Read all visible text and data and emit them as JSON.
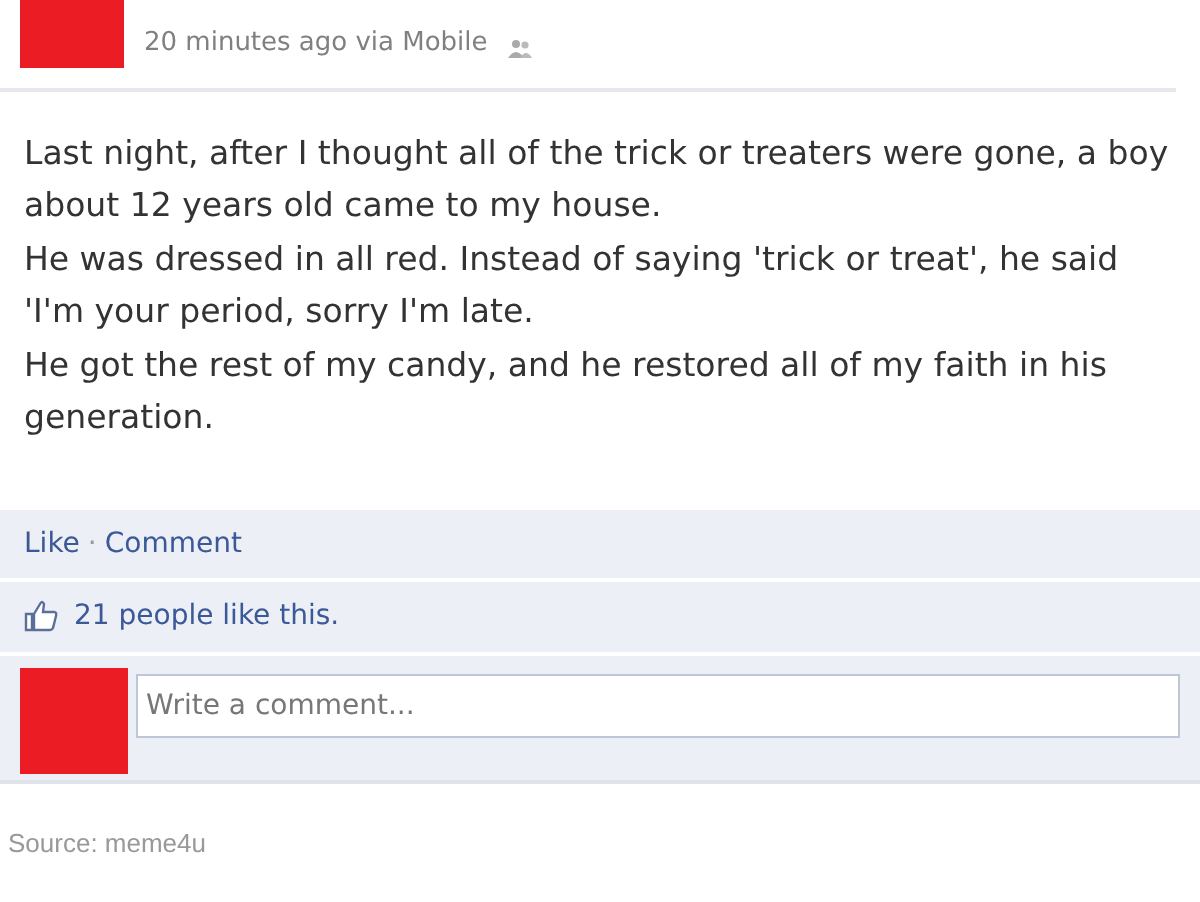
{
  "post": {
    "timestamp": "20 minutes ago via Mobile",
    "paragraphs": [
      "Last night, after I thought all of the trick or treaters were gone, a boy about 12 years old came to my house.",
      "He was dressed in all red. Instead of saying 'trick or treat', he said 'I'm your period, sorry I'm late.",
      "He got the rest of my candy, and he restored all of my faith in his generation."
    ]
  },
  "actions": [
    {
      "label": "Like"
    },
    {
      "label": "Comment"
    }
  ],
  "separator": "·",
  "likes": "21 people like this.",
  "comment_box": {
    "placeholder": "Write a comment..."
  },
  "source": "Source: meme4u"
}
